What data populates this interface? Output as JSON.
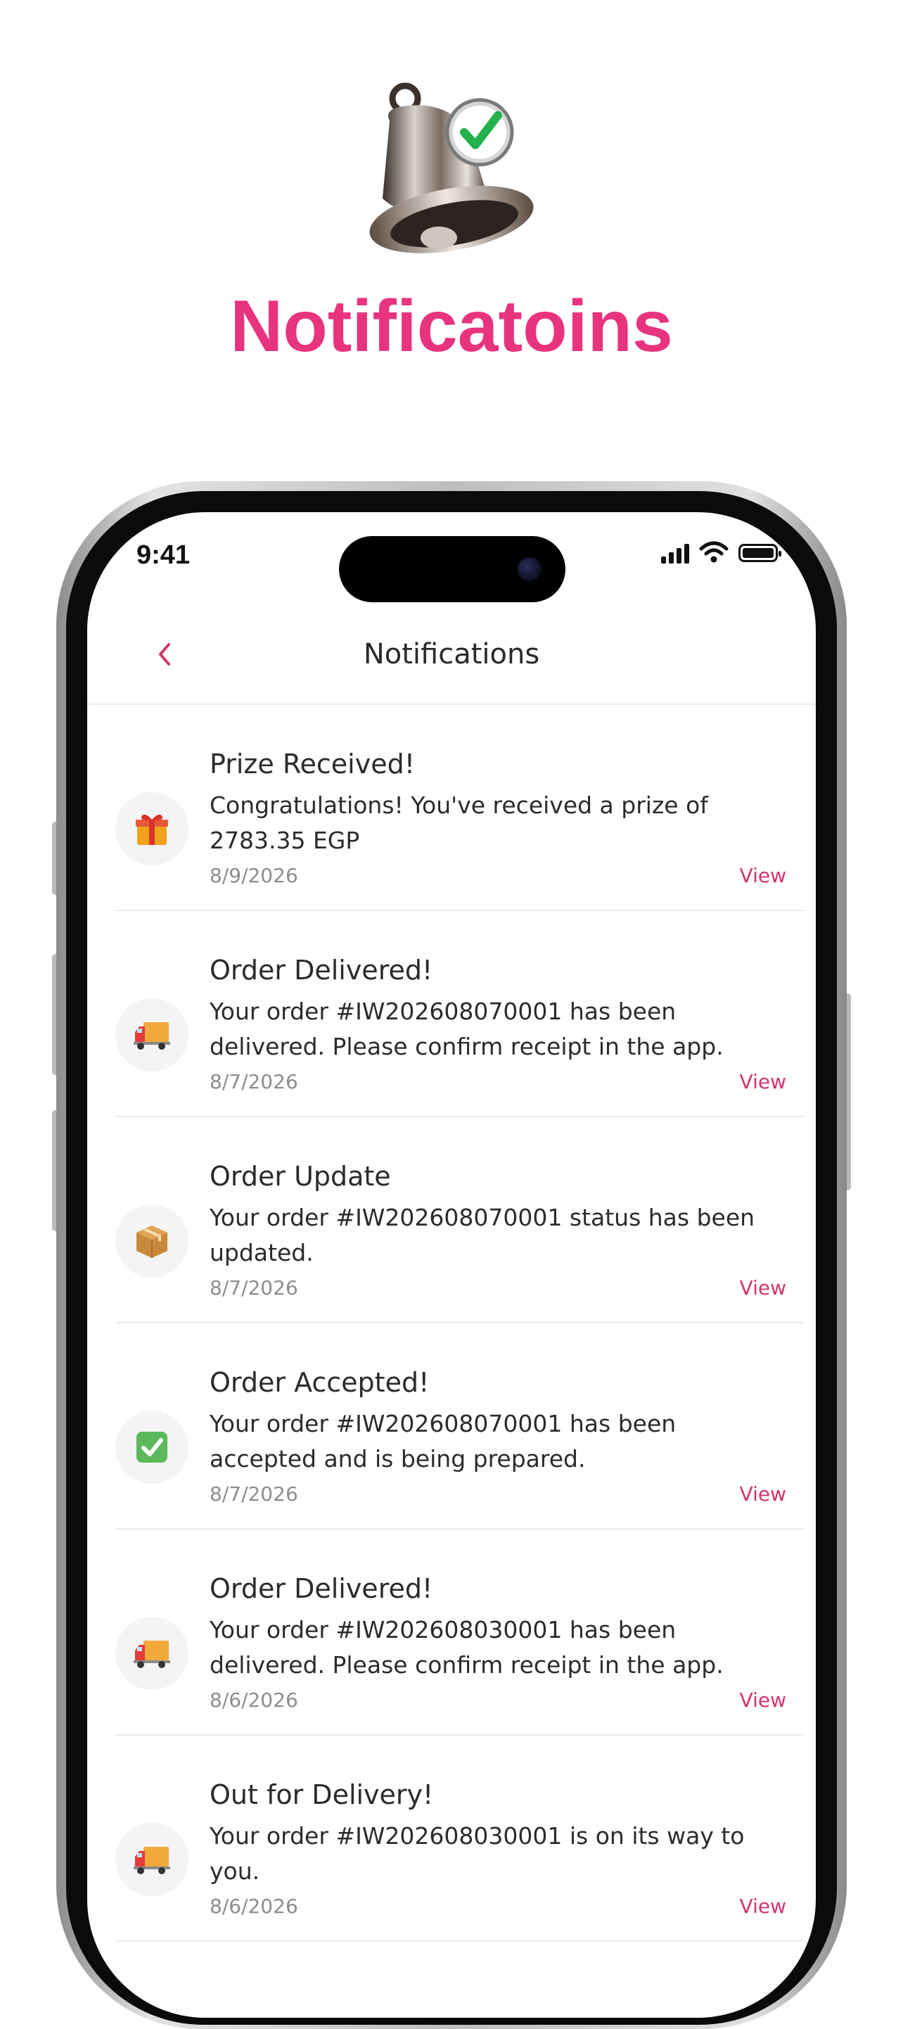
{
  "hero": {
    "title": "Notificatoins",
    "icon": "bell-check-icon"
  },
  "status_bar": {
    "time": "9:41",
    "icons": [
      "signal-icon",
      "wifi-icon",
      "battery-icon"
    ]
  },
  "header": {
    "back_icon": "chevron-left-icon",
    "title": "Notifications"
  },
  "colors": {
    "accent": "#e8337f",
    "view_link": "#d3336f"
  },
  "notifications": [
    {
      "icon": "gift-icon",
      "title": "Prize Received!",
      "body": "Congratulations! You've received a prize of 2783.35 EGP",
      "date": "8/9/2026",
      "action": "View"
    },
    {
      "icon": "delivery-truck-icon",
      "title": "Order Delivered!",
      "body": "Your order #IW202608070001 has been delivered. Please confirm receipt in the app.",
      "date": "8/7/2026",
      "action": "View"
    },
    {
      "icon": "package-icon",
      "title": "Order Update",
      "body": "Your order #IW202608070001 status has been updated.",
      "date": "8/7/2026",
      "action": "View"
    },
    {
      "icon": "check-mark-icon",
      "title": "Order Accepted!",
      "body": "Your order #IW202608070001 has been accepted and is being prepared.",
      "date": "8/7/2026",
      "action": "View"
    },
    {
      "icon": "delivery-truck-icon",
      "title": "Order Delivered!",
      "body": "Your order #IW202608030001 has been delivered. Please confirm receipt in the app.",
      "date": "8/6/2026",
      "action": "View"
    },
    {
      "icon": "delivery-truck-icon",
      "title": "Out for Delivery!",
      "body": "Your order #IW202608030001 is on its way to you.",
      "date": "8/6/2026",
      "action": "View"
    }
  ]
}
